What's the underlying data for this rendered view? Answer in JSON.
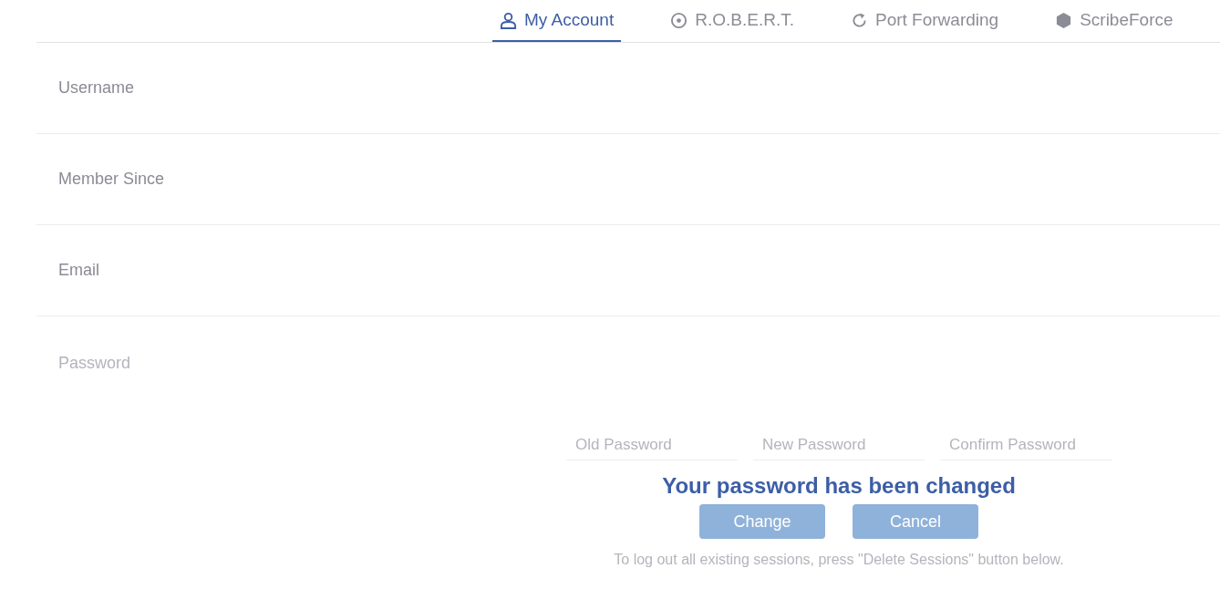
{
  "tabs": [
    {
      "label": "My Account",
      "selected": true
    },
    {
      "label": "R.O.B.E.R.T.",
      "selected": false
    },
    {
      "label": "Port Forwarding",
      "selected": false
    },
    {
      "label": "ScribeForce",
      "selected": false
    }
  ],
  "info_rows": [
    {
      "label": "Username"
    },
    {
      "label": "Member Since"
    },
    {
      "label": "Email"
    }
  ],
  "password_section": {
    "label": "Password",
    "dimmed": true,
    "fields": [
      {
        "placeholder": "Old Password"
      },
      {
        "placeholder": "New Password"
      },
      {
        "placeholder": "Confirm Password"
      }
    ],
    "buttons": [
      "Change",
      "Cancel"
    ],
    "note": "To log out all existing sessions, press \"Delete Sessions\" button below."
  },
  "notice": {
    "text": "Your password has been changed"
  }
}
